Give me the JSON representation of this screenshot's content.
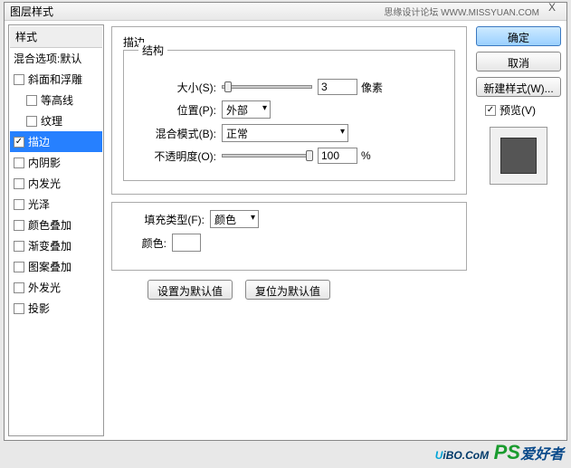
{
  "dialog": {
    "title": "图层样式",
    "watermark_bar": "思缘设计论坛  WWW.MISSYUAN.COM",
    "close": "X"
  },
  "left": {
    "header": "样式",
    "blend_defaults": "混合选项:默认",
    "items": [
      {
        "label": "斜面和浮雕",
        "checked": false,
        "sub": false
      },
      {
        "label": "等高线",
        "checked": false,
        "sub": true
      },
      {
        "label": "纹理",
        "checked": false,
        "sub": true
      },
      {
        "label": "描边",
        "checked": true,
        "sub": false,
        "selected": true
      },
      {
        "label": "内阴影",
        "checked": false,
        "sub": false
      },
      {
        "label": "内发光",
        "checked": false,
        "sub": false
      },
      {
        "label": "光泽",
        "checked": false,
        "sub": false
      },
      {
        "label": "颜色叠加",
        "checked": false,
        "sub": false
      },
      {
        "label": "渐变叠加",
        "checked": false,
        "sub": false
      },
      {
        "label": "图案叠加",
        "checked": false,
        "sub": false
      },
      {
        "label": "外发光",
        "checked": false,
        "sub": false
      },
      {
        "label": "投影",
        "checked": false,
        "sub": false
      }
    ]
  },
  "center": {
    "title": "描边",
    "structure": {
      "title": "结构",
      "size_label": "大小(S):",
      "size_value": "3",
      "size_unit": "像素",
      "position_label": "位置(P):",
      "position_value": "外部",
      "blend_label": "混合模式(B):",
      "blend_value": "正常",
      "opacity_label": "不透明度(O):",
      "opacity_value": "100",
      "opacity_unit": "%"
    },
    "fill": {
      "fill_type_label": "填充类型(F):",
      "fill_type_value": "颜色",
      "color_label": "颜色:",
      "color_value": "#ffffff"
    },
    "buttons": {
      "set_default": "设置为默认值",
      "reset_default": "复位为默认值"
    }
  },
  "right": {
    "ok": "确定",
    "cancel": "取消",
    "new_style": "新建样式(W)...",
    "preview_label": "预览(V)",
    "preview_checked": true
  },
  "watermark": {
    "u": "U",
    "ibo": "iBO",
    "com": ".CoM",
    "ps": "PS",
    "cn": "爱好者"
  }
}
